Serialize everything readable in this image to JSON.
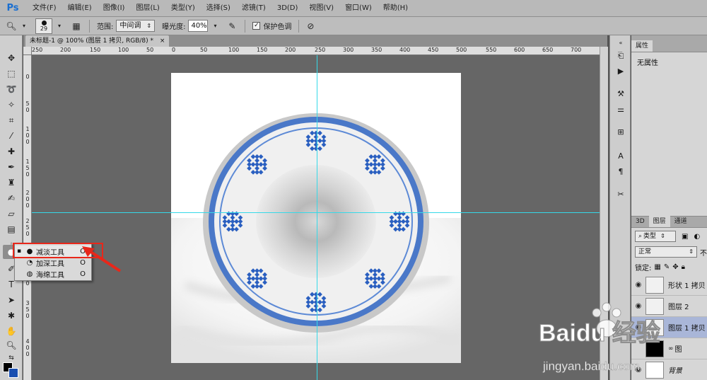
{
  "menubar": {
    "app_logo": "Ps",
    "items": [
      "文件(F)",
      "编辑(E)",
      "图像(I)",
      "图层(L)",
      "类型(Y)",
      "选择(S)",
      "滤镜(T)",
      "3D(D)",
      "视图(V)",
      "窗口(W)",
      "帮助(H)"
    ]
  },
  "options": {
    "brush_size": "29",
    "range_label": "范围:",
    "range_value": "中间调",
    "exposure_label": "曝光度:",
    "exposure_value": "40%",
    "protect_tones_label": "保护色调",
    "protect_tones_checked": true
  },
  "document": {
    "tab_title": "未标题-1 @ 100% (图层 1 拷贝, RGB/8) *",
    "close_glyph": "×"
  },
  "rulers": {
    "top_labels": [
      "250",
      "200",
      "150",
      "100",
      "50",
      "0",
      "50",
      "100",
      "150",
      "200",
      "250",
      "300",
      "350",
      "400",
      "450",
      "500",
      "550",
      "600",
      "650",
      "700"
    ],
    "left_labels": [
      "0",
      "5 0",
      "1 0 0",
      "1 5 0",
      "2 0 0",
      "2 5 0",
      "3 0 0",
      "3 5 0",
      "4 0 0"
    ]
  },
  "flyout": {
    "items": [
      {
        "label": "减淡工具",
        "shortcut": "O",
        "icon": "dodge-icon",
        "selected": true
      },
      {
        "label": "加深工具",
        "shortcut": "O",
        "icon": "burn-icon",
        "selected": false
      },
      {
        "label": "海绵工具",
        "shortcut": "O",
        "icon": "sponge-icon",
        "selected": false
      }
    ]
  },
  "properties": {
    "tab_label": "属性",
    "text": "无属性"
  },
  "layers_panel": {
    "tabs": [
      "3D",
      "图层",
      "通道"
    ],
    "active_tab": "图层",
    "kind_filter": "类型",
    "blend_mode": "正常",
    "opacity_label": "不",
    "lock_label": "锁定:",
    "layers": [
      {
        "name": "形状 1 拷贝",
        "visible": true,
        "selected": false,
        "thumb": "checker"
      },
      {
        "name": "图层 2",
        "visible": true,
        "selected": false,
        "thumb": "checker"
      },
      {
        "name": "图层 1 拷贝",
        "visible": true,
        "selected": true,
        "thumb": "checker"
      },
      {
        "name": "图",
        "visible": false,
        "selected": false,
        "thumb": "mask"
      },
      {
        "name": "背景",
        "visible": true,
        "selected": false,
        "thumb": "white"
      }
    ]
  },
  "watermark": {
    "brand": "Baidu 经验",
    "url": "jingyan.baidu.com"
  },
  "colors": {
    "accent_blue": "#1a4fb0",
    "guide_cyan": "#35d9e8",
    "highlight_red": "#e8271a",
    "plate_blue": "#3a6fc4"
  }
}
